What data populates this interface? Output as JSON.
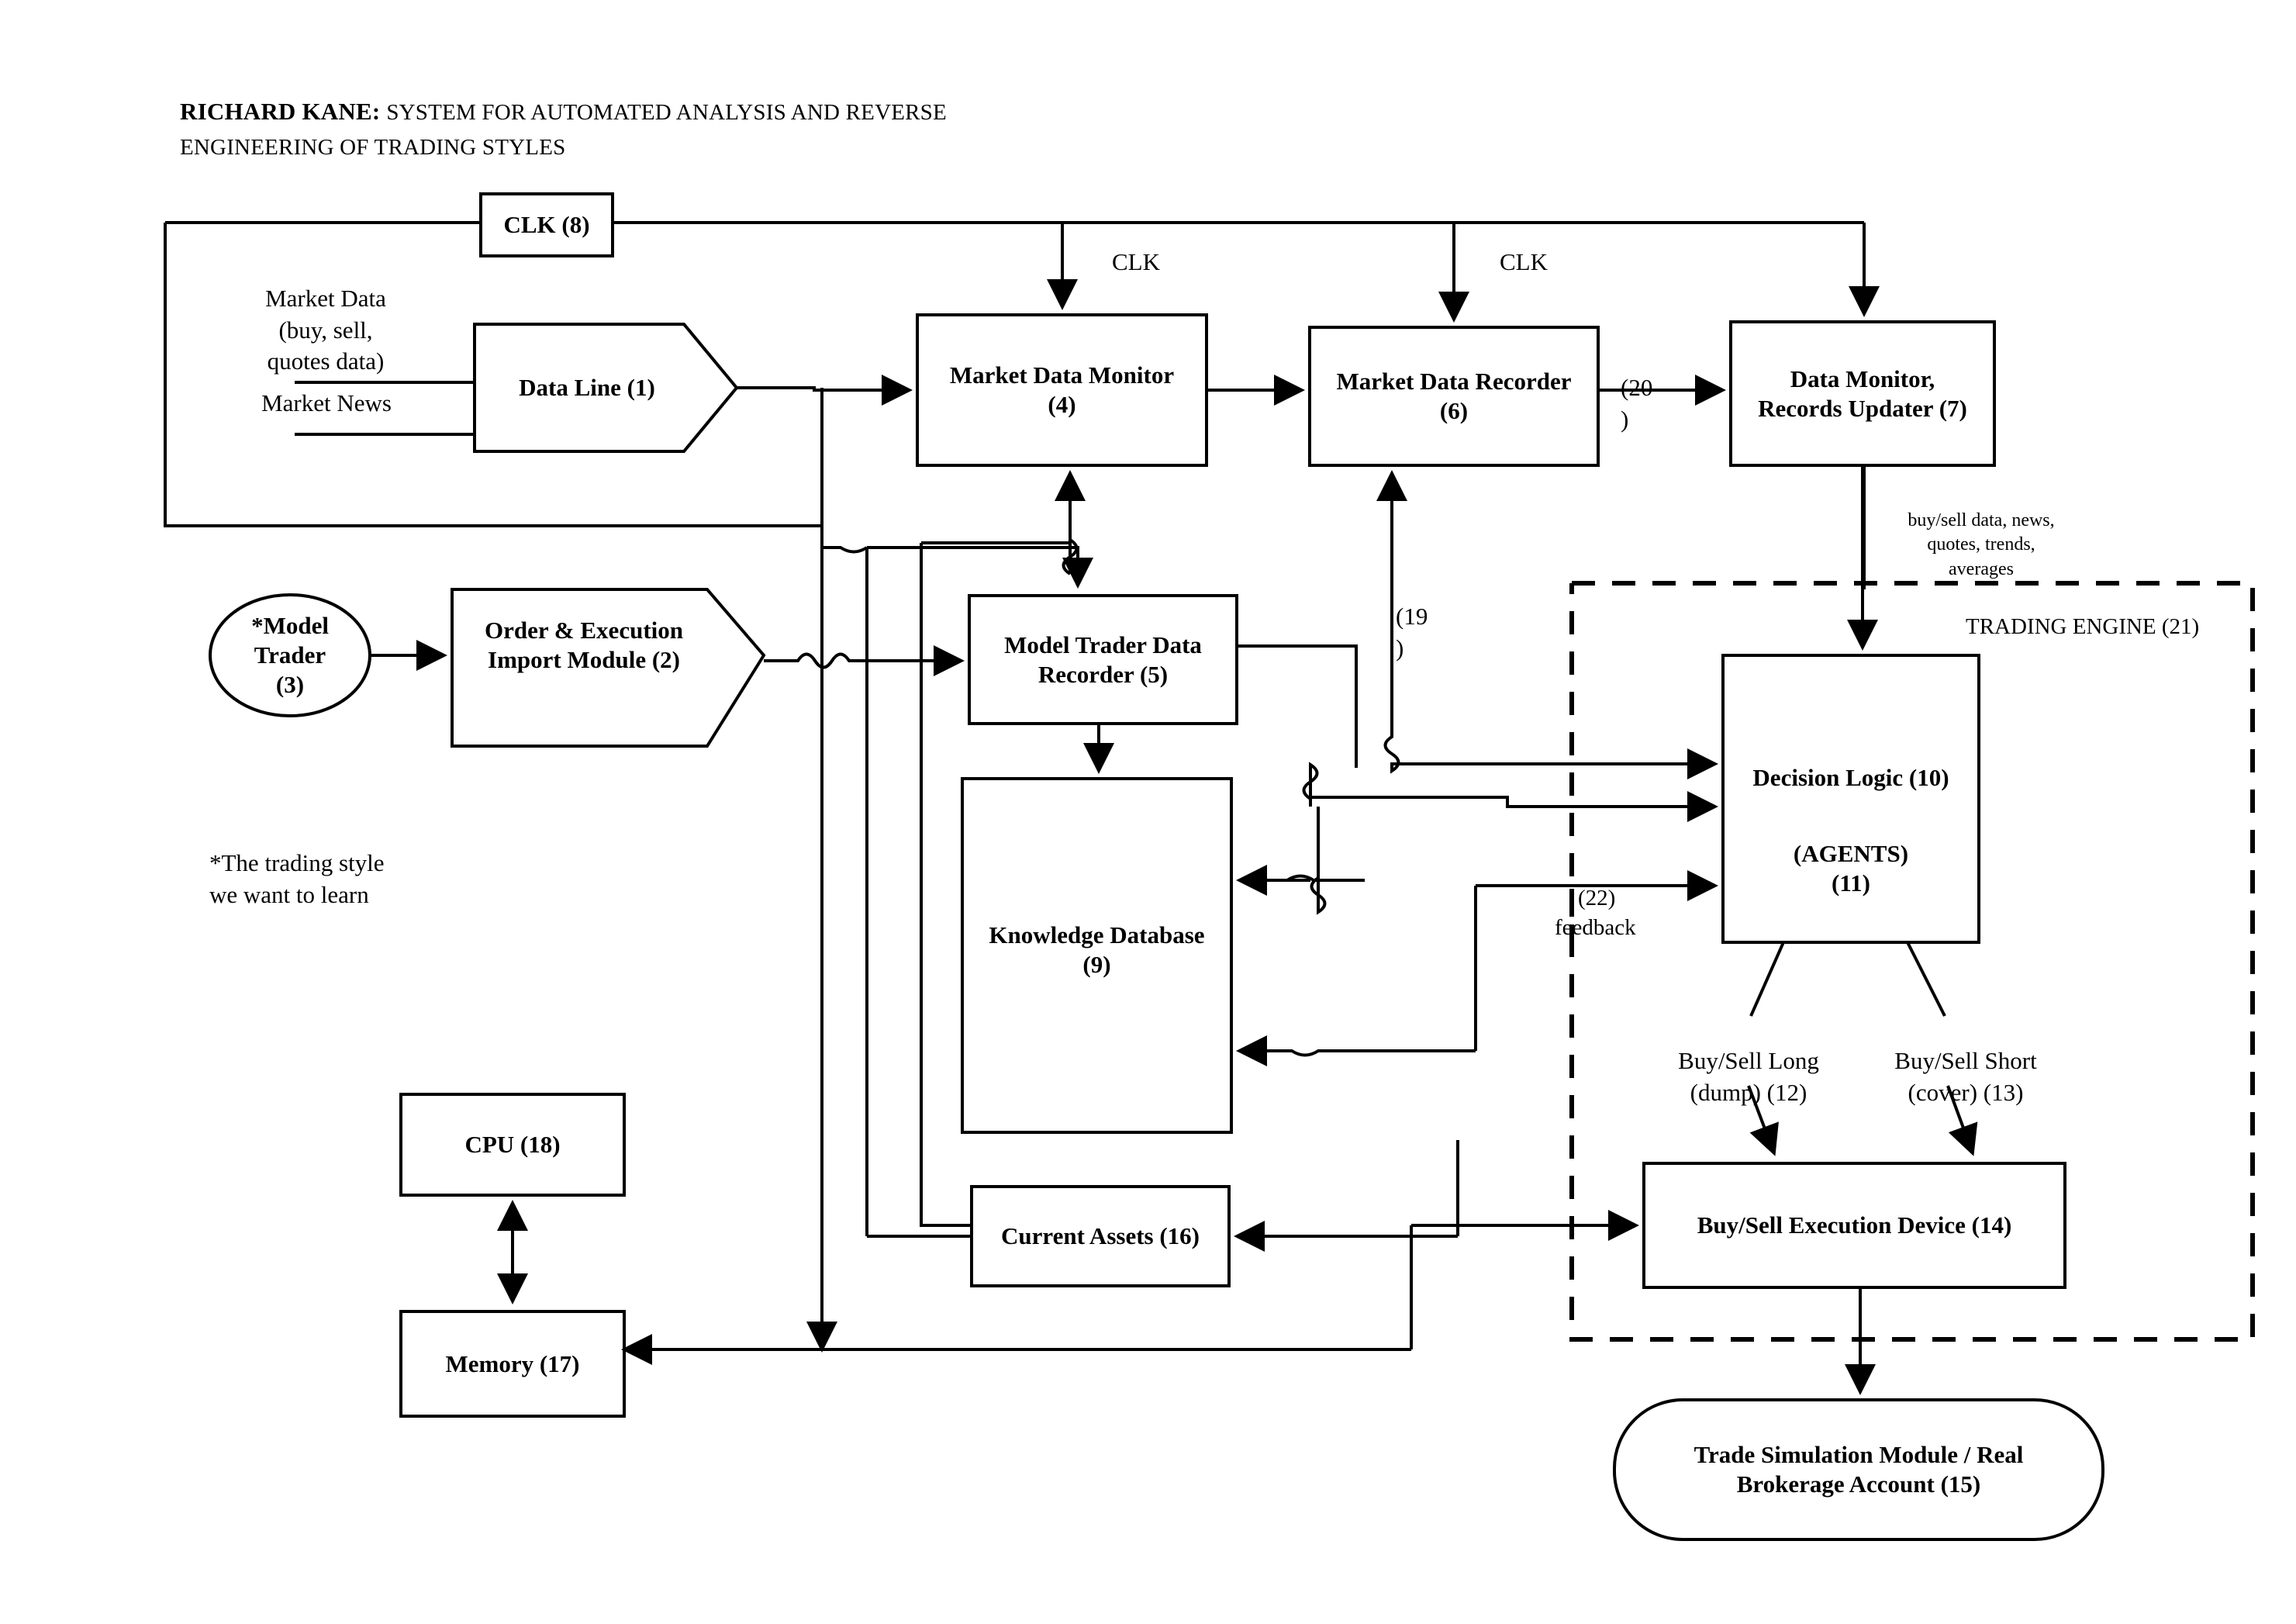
{
  "figure": {
    "header_name": "RICHARD KANE:",
    "header_title_line1": "SYSTEM FOR AUTOMATED ANALYSIS AND REVERSE",
    "header_title_line2": "ENGINEERING OF TRADING STYLES"
  },
  "nodes": {
    "clk8": "CLK (8)",
    "data_line": "Data Line (1)",
    "market_data_monitor": "Market Data Monitor\n(4)",
    "market_data_recorder": "Market Data Recorder\n(6)",
    "data_monitor_records_updater": "Data Monitor,\nRecords Updater (7)",
    "model_trader": "*Model\nTrader\n(3)",
    "order_exec_import": "Order & Execution\nImport Module (2)",
    "model_trader_data_recorder": "Model Trader Data\nRecorder (5)",
    "knowledge_database": "Knowledge Database\n(9)",
    "current_assets": "Current Assets (16)",
    "cpu": "CPU (18)",
    "memory": "Memory (17)",
    "decision_logic": "Decision Logic (10)",
    "agents": "(AGENTS)\n(11)",
    "buy_sell_execution": "Buy/Sell Execution Device (14)",
    "trade_simulation": "Trade Simulation Module / Real\nBrokerage Account (15)"
  },
  "labels": {
    "market_data": "Market Data\n(buy, sell,\nquotes data)",
    "market_news": "Market News",
    "clk_mid_left": "CLK",
    "clk_mid_right": "CLK",
    "ref20": "(20\n)",
    "ref19": "(19\n)",
    "ref22_line1": "(22)",
    "ref22_line2": "feedback",
    "data_annotation": "buy/sell data, news,\nquotes, trends,\naverages",
    "trading_engine": "TRADING ENGINE (21)",
    "buy_sell_long": "Buy/Sell Long\n(dump) (12)",
    "buy_sell_short": "Buy/Sell Short\n(cover) (13)",
    "footnote": "*The trading style\nwe want to learn"
  },
  "colors": {
    "ink": "#000000",
    "paper": "#ffffff"
  }
}
